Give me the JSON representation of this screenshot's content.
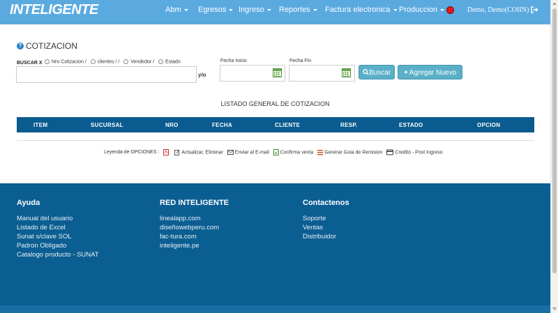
{
  "brand": {
    "logo_light": "INTELI",
    "logo_bold": "GENTE"
  },
  "nav": {
    "items": [
      {
        "label": "Abm"
      },
      {
        "label": "Egresos"
      },
      {
        "label": "Ingreso"
      },
      {
        "label": "Reportes"
      },
      {
        "label": "Factura electronica"
      },
      {
        "label": "Produccion"
      }
    ],
    "user": "Demo, Demo(COIIN)",
    "status_color": "#e21a1a"
  },
  "page": {
    "title_icon": "?",
    "title": "COTIZACION"
  },
  "filter": {
    "buscar_label": "BUSCAR X",
    "radios": [
      {
        "label": "Nro Cotizacion /"
      },
      {
        "label": "clientes / /"
      },
      {
        "label": "Vendedor /"
      },
      {
        "label": "Estado"
      }
    ],
    "search_value": "",
    "yo_label": "y/o",
    "fecha_inicio_label": "Fecha Inicio",
    "fecha_fin_label": "Fecha Fin",
    "fecha_inicio_value": "",
    "fecha_fin_value": "",
    "buscar_button": "Buscar",
    "nuevo_button": "Agregar Nuevo"
  },
  "list": {
    "title": "LISTADO GENERAL DE COTIZACION",
    "columns": [
      "ITEM",
      "SUCURSAL",
      "NRO",
      "FECHA",
      "CLIENTE",
      "RESP.",
      "ESTADO",
      "OPCION"
    ]
  },
  "legend": {
    "label": "Leyenda de OPCIONES :",
    "items": [
      {
        "label": "Actualizar, Eliminar"
      },
      {
        "label": "Enviar al E-mail"
      },
      {
        "label": "Confirma venta"
      },
      {
        "label": "Generar Guia de Remision"
      },
      {
        "label": "Credito - Post Ingreso"
      }
    ]
  },
  "footer": {
    "ayuda": {
      "title": "Ayuda",
      "links": [
        "Manual del usuario",
        "Listado de Excel",
        "Sunat s/clave SOL",
        "Padron Obligado",
        "Catalogo producto - SUNAT"
      ]
    },
    "red": {
      "title": "RED INTELIGENTE",
      "links": [
        "linealapp.com",
        "diseñowebperu.com",
        "fac-tura.com",
        "inteligente.pe"
      ]
    },
    "contacto": {
      "title": "Contactenos",
      "links": [
        "Soporte",
        "Ventas",
        "Distribuidor"
      ]
    }
  }
}
